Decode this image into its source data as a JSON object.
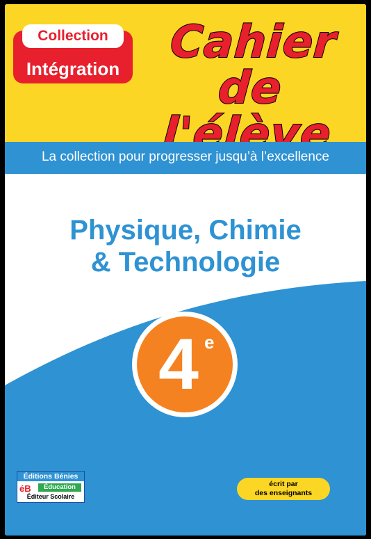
{
  "badge": {
    "line1": "Collection",
    "line2": "Intégration"
  },
  "title": {
    "line1": "Cahier",
    "line2": "de l'élève"
  },
  "tagline": "La collection pour progresser jusqu’à l’excellence",
  "subject": {
    "line1": "Physique, Chimie",
    "line2": "& Technologie"
  },
  "grade": {
    "number": "4",
    "suffix": "e"
  },
  "publisher": {
    "name": "Éditions Bénies",
    "initials": "éB",
    "tag": "Éducation",
    "subtitle": "Éditeur Scolaire"
  },
  "authors_badge": {
    "line1": "écrit par",
    "line2": "des enseignants"
  },
  "colors": {
    "yellow": "#fbd624",
    "blue": "#2e92d3",
    "red": "#e81f2c",
    "orange": "#f58220"
  }
}
